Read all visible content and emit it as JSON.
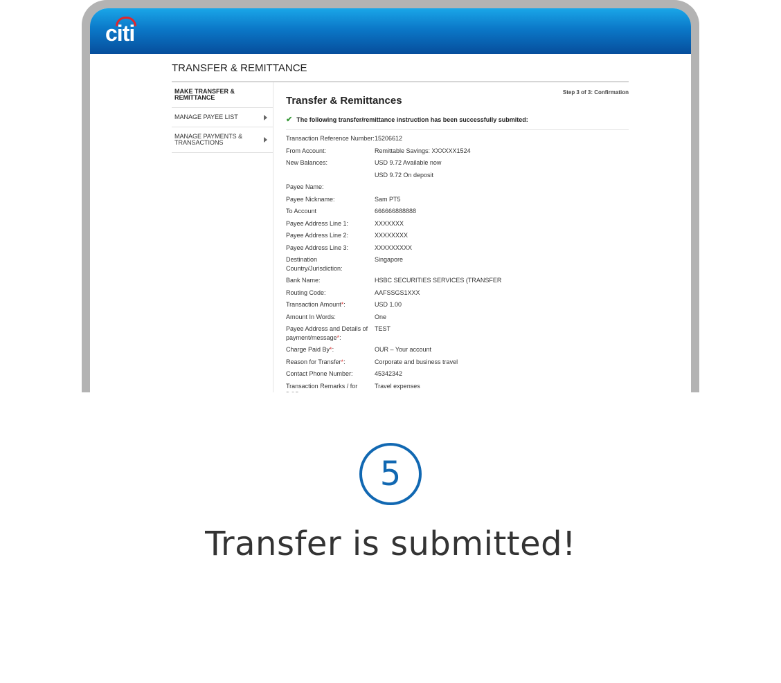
{
  "header": {
    "logo": "citi"
  },
  "page": {
    "title": "TRANSFER & REMITTANCE",
    "step": "Step 3 of 3: Confirmation",
    "heading": "Transfer & Remittances",
    "success_message": "The following transfer/remittance instruction has been successfully submited:"
  },
  "sidebar": {
    "items": [
      {
        "label": "MAKE TRANSFER & REMITTANCE"
      },
      {
        "label": "MANAGE PAYEE LIST"
      },
      {
        "label": "MANAGE PAYMENTS & TRANSACTIONS"
      }
    ]
  },
  "details": [
    {
      "label": "Transaction Reference Number:",
      "value": "15206612"
    },
    {
      "label": "From Account:",
      "value": "Remittable Savings: XXXXXX1524"
    },
    {
      "label": "New Balances:",
      "value": "USD 9.72 Available now"
    },
    {
      "label": "",
      "value": "USD 9.72 On deposit"
    },
    {
      "label": "Payee Name:",
      "value": ""
    },
    {
      "label": "Payee Nickname:",
      "value": "Sam PT5"
    },
    {
      "label": "To Account",
      "value": "666666888888"
    },
    {
      "label": "Payee Address Line 1:",
      "value": "XXXXXXX"
    },
    {
      "label": "Payee Address Line 2:",
      "value": "XXXXXXXX"
    },
    {
      "label": "Payee Address Line 3:",
      "value": "XXXXXXXXX"
    },
    {
      "label": "Destination Country/Jurisdiction:",
      "value": "Singapore"
    },
    {
      "label": "Bank Name:",
      "value": "HSBC SECURITIES SERVICES (TRANSFER"
    },
    {
      "label": "Routing Code:",
      "value": "AAFSSGS1XXX"
    },
    {
      "label": "Transaction Amount",
      "req": "*",
      "suffix": ":",
      "value": "USD 1.00"
    },
    {
      "label": "Amount In Words:",
      "value": "One"
    },
    {
      "label": "Payee Address and Details of payment/message",
      "req": "*",
      "suffix": ":",
      "value": "TEST"
    },
    {
      "label": "Charge Paid By",
      "req": "*",
      "suffix": ":",
      "value": "OUR – Your account"
    },
    {
      "label": "Reason for Transfer",
      "req": "*",
      "suffix": ":",
      "value": "Corporate and business travel"
    },
    {
      "label": "Contact Phone Number:",
      "value": "45342342"
    },
    {
      "label": "Transaction Remarks / for DOD:",
      "value": "Travel expenses"
    }
  ],
  "footer": {
    "step_number": "5",
    "caption": "Transfer is submitted!"
  },
  "colors": {
    "header_blue": "#0b78c8",
    "step_blue": "#1168b2",
    "logo_arc_red": "#e2262b",
    "success_green": "#3a9a3a"
  }
}
